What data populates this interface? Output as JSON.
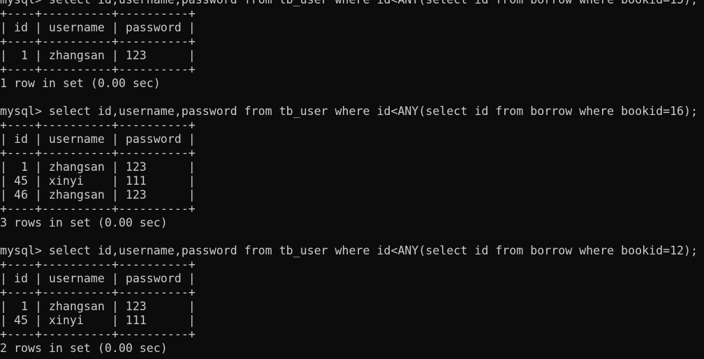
{
  "terminal": {
    "lines": [
      "mysql> select id,username,password from tb_user where id<ANY(select id from borrow where bookid=15);",
      "+----+----------+----------+",
      "| id | username | password |",
      "+----+----------+----------+",
      "|  1 | zhangsan | 123      |",
      "+----+----------+----------+",
      "1 row in set (0.00 sec)",
      "",
      "mysql> select id,username,password from tb_user where id<ANY(select id from borrow where bookid=16);",
      "+----+----------+----------+",
      "| id | username | password |",
      "+----+----------+----------+",
      "|  1 | zhangsan | 123      |",
      "| 45 | xinyi    | 111      |",
      "| 46 | zhangsan | 123      |",
      "+----+----------+----------+",
      "3 rows in set (0.00 sec)",
      "",
      "mysql> select id,username,password from tb_user where id<ANY(select id from borrow where bookid=12);",
      "+----+----------+----------+",
      "| id | username | password |",
      "+----+----------+----------+",
      "|  1 | zhangsan | 123      |",
      "| 45 | xinyi    | 111      |",
      "+----+----------+----------+",
      "2 rows in set (0.00 sec)"
    ]
  }
}
